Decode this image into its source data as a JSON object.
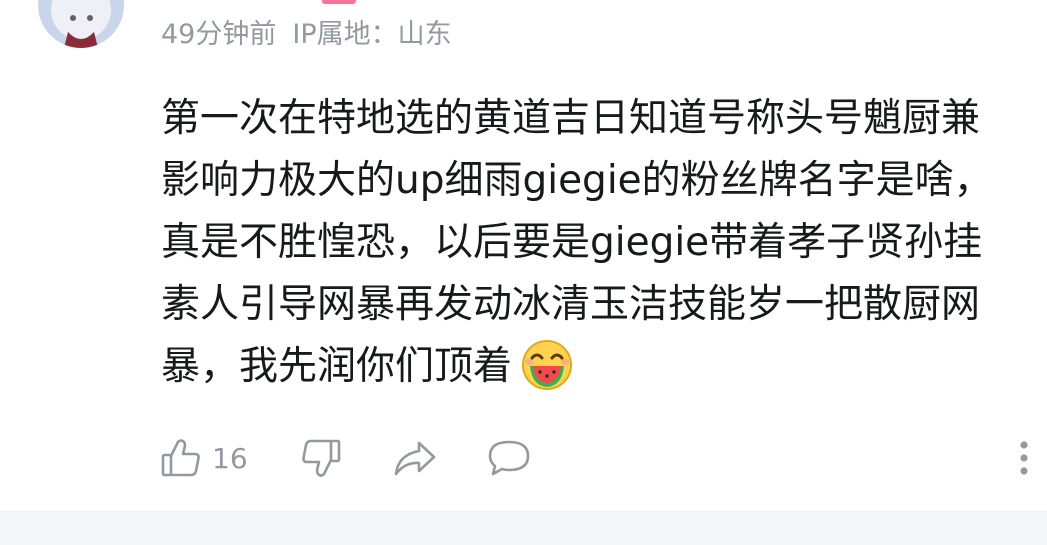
{
  "comment": {
    "meta": {
      "time": "49分钟前",
      "ip_location": "IP属地：山东"
    },
    "content_lines": [
      "第一次在特地选的黄道吉日知道号称头号魈厨兼",
      "影响力极大的up细雨giegie的粉丝牌名字是啥，",
      "真是不胜惶恐，以后要是giegie带着孝子贤孙挂",
      "素人引导网暴再发动冰清玉洁技能岁一把散厨网",
      "暴，我先润你们顶着"
    ],
    "emoji": "watermelon-laughing-emoji",
    "actions": {
      "like_count": "16"
    }
  },
  "icons": {
    "like": "thumbs-up-icon",
    "dislike": "thumbs-down-icon",
    "share": "share-icon",
    "reply": "comment-bubble-icon",
    "more": "more-vertical-icon"
  },
  "colors": {
    "text": "#18191c",
    "muted": "#9499a0",
    "accent": "#fb7299"
  }
}
